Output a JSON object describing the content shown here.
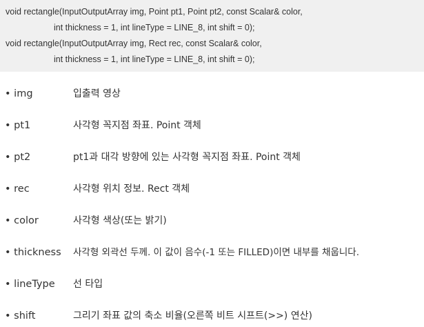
{
  "code": {
    "lines": [
      "void rectangle(InputOutputArray img, Point pt1, Point pt2, const Scalar& color,",
      "int thickness = 1, int lineType = LINE_8, int shift = 0);",
      "void rectangle(InputOutputArray img, Rect rec, const Scalar& color,",
      "int thickness = 1, int lineType = LINE_8, int shift = 0);"
    ]
  },
  "params": [
    {
      "name": "• img",
      "desc": "입출력 영상"
    },
    {
      "name": "• pt1",
      "desc": "사각형 꼭지점 좌표. Point 객체"
    },
    {
      "name": "• pt2",
      "desc": "pt1과 대각 방향에 있는 사각형 꼭지점 좌표. Point 객체"
    },
    {
      "name": "• rec",
      "desc": "사각형 위치 정보. Rect 객체"
    },
    {
      "name": "• color",
      "desc": "사각형 색상(또는 밝기)"
    },
    {
      "name": "• thickness",
      "desc": "사각형 외곽선 두께. 이 값이 음수(-1 또는 FILLED)이면 내부를 채웁니다."
    },
    {
      "name": "• lineType",
      "desc": "선 타입"
    },
    {
      "name": "• shift",
      "desc": "그리기 좌표 값의 축소 비율(오른쪽 비트 시프트(>>) 연산)"
    }
  ]
}
